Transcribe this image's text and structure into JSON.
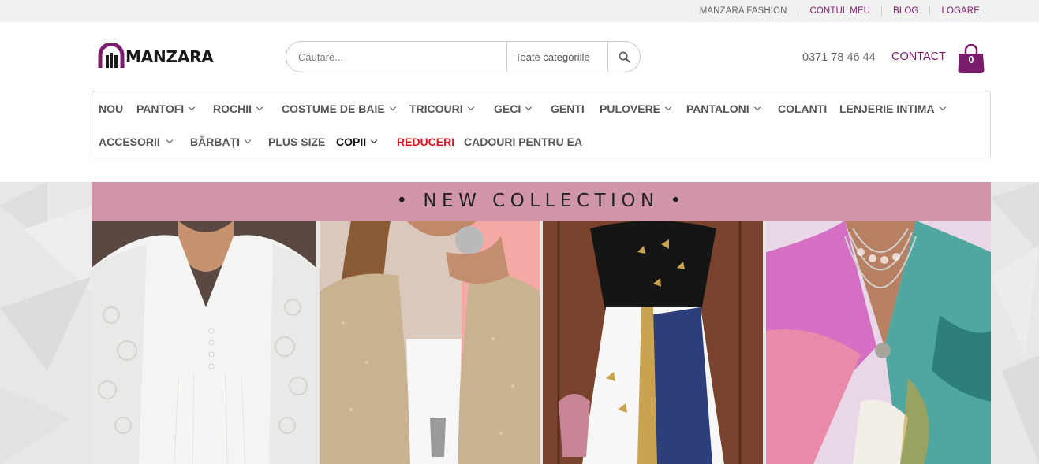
{
  "topbar": {
    "links": [
      {
        "label": "MANZARA FASHION",
        "color": "#666666"
      },
      {
        "label": "CONTUL MEU",
        "color": "#7a1c6c"
      },
      {
        "label": "BLOG",
        "color": "#7a1c6c"
      },
      {
        "label": "LOGARE",
        "color": "#7a1c6c"
      }
    ]
  },
  "header": {
    "brand": "MANZARA",
    "search_placeholder": "Căutare...",
    "category": "Toate categoriile",
    "phone": "0371 78 46 44",
    "contact": "CONTACT",
    "cart_count": "0",
    "accent": "#7a1c6c"
  },
  "nav": {
    "row1": [
      "NOU",
      "PANTOFI",
      "ROCHII",
      "COSTUME DE BAIE",
      "TRICOURI",
      "GECI",
      "GENTI",
      "PULOVERE",
      "PANTALONI",
      "COLANTI",
      "LENJERIE INTIMA"
    ],
    "row2": [
      "ACCESORII",
      "BĂRBAȚI",
      "PLUS SIZE",
      "COPII",
      "REDUCERI",
      "CADOURI PENTRU EA"
    ]
  },
  "hero": {
    "banner": "•  NEW COLLECTION  •",
    "banner_color": "#d095a7"
  }
}
